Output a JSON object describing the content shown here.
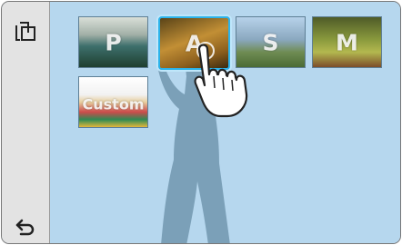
{
  "sidebar": {
    "top_icon": "multi-frame-icon",
    "bottom_icon": "return-arrow-icon"
  },
  "modes": [
    {
      "label": "P",
      "state": "normal"
    },
    {
      "label": "A",
      "state": "selected"
    },
    {
      "label": "S",
      "state": "normal"
    },
    {
      "label": "M",
      "state": "normal"
    },
    {
      "label": "Custom",
      "state": "normal"
    }
  ],
  "colors": {
    "screen_bg": "#b6d7ee",
    "sidebar_bg": "#e3e3e3",
    "selection": "#2cb3ea",
    "silhouette": "#7ba0b8"
  },
  "overlay_icon": "touch-hand-icon"
}
